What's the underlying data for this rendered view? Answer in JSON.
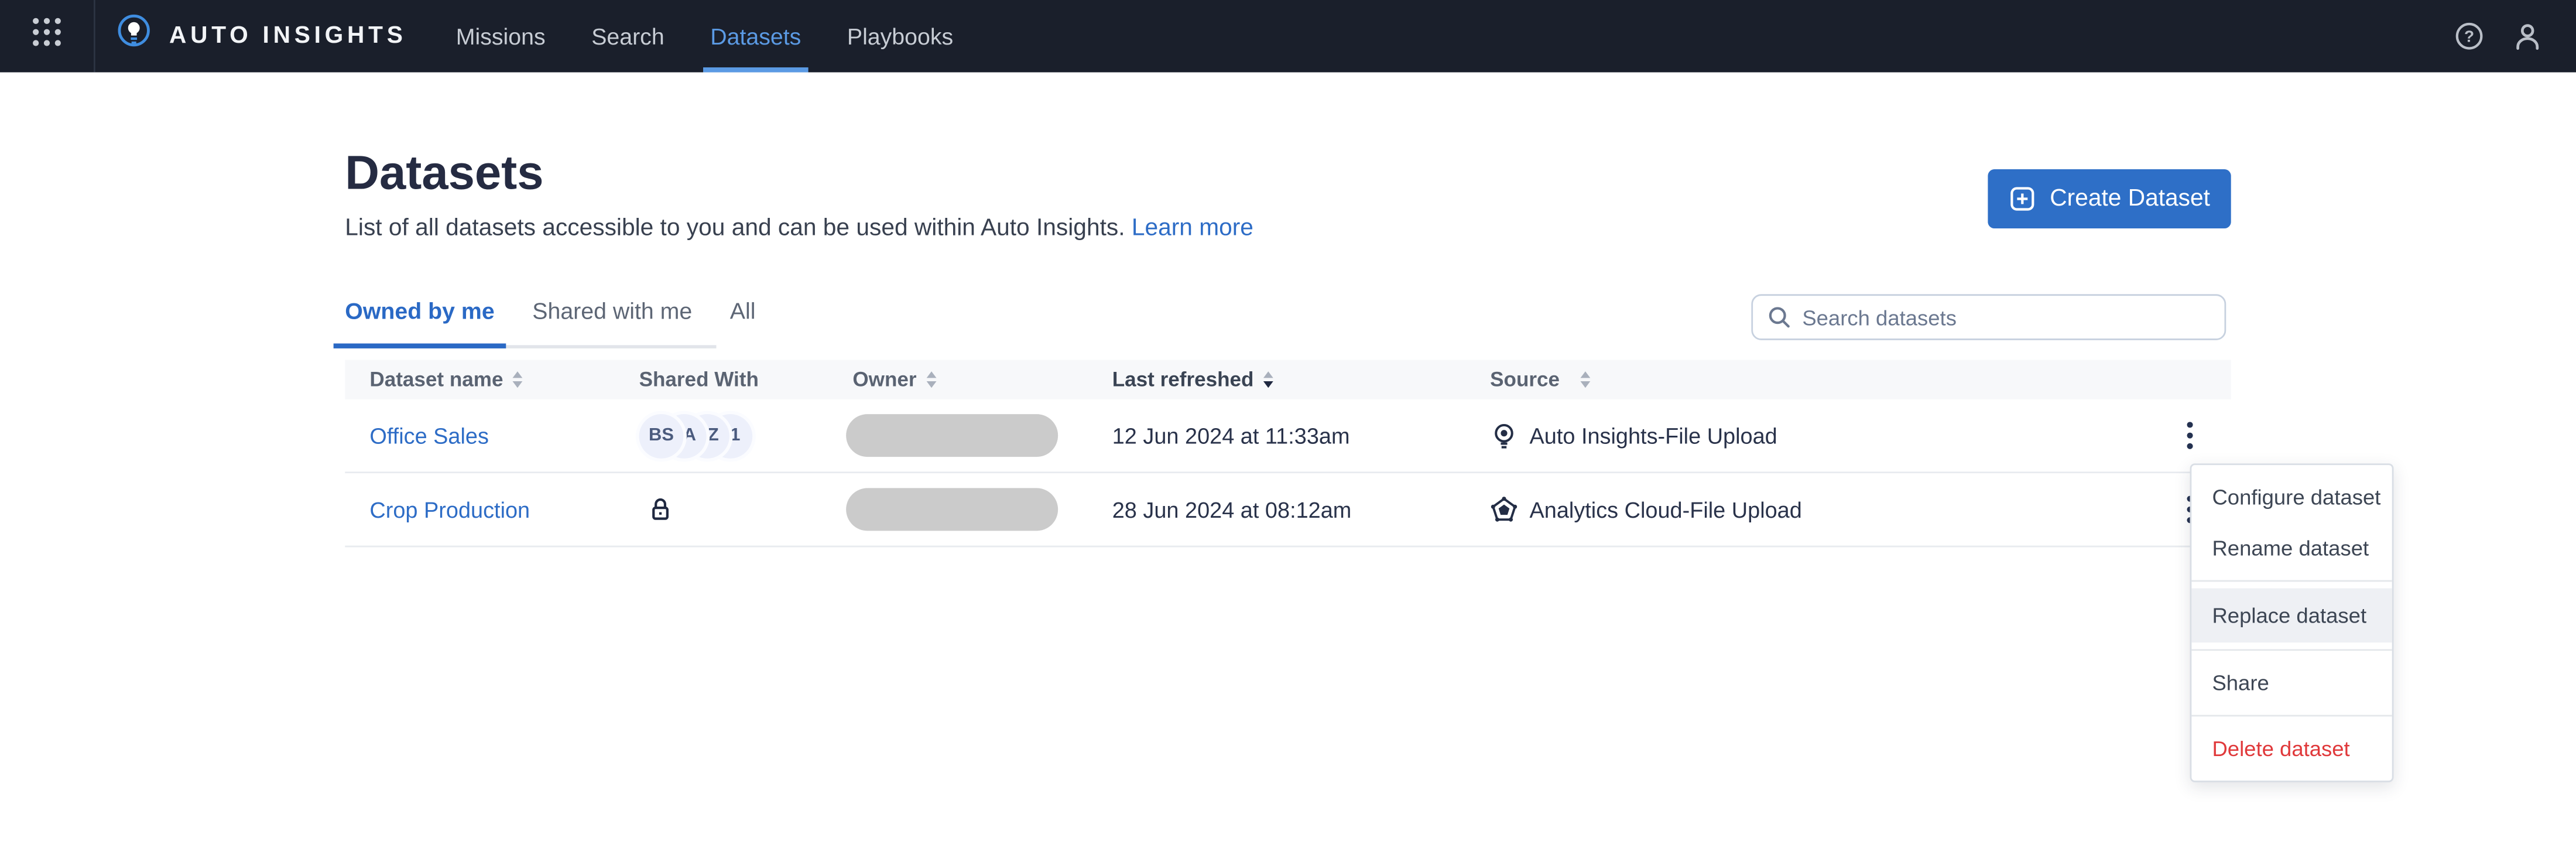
{
  "nav": {
    "brand": "AUTO INSIGHTS",
    "items": [
      {
        "label": "Missions",
        "active": false
      },
      {
        "label": "Search",
        "active": false
      },
      {
        "label": "Datasets",
        "active": true
      },
      {
        "label": "Playbooks",
        "active": false
      }
    ]
  },
  "page": {
    "title": "Datasets",
    "subtitle": "List of all datasets accessible to you and can be used within Auto Insights.",
    "learn_more_label": "Learn more",
    "create_button_label": "Create Dataset"
  },
  "tabs": {
    "items": [
      {
        "label": "Owned by me",
        "active": true
      },
      {
        "label": "Shared with me",
        "active": false
      },
      {
        "label": "All",
        "active": false
      }
    ]
  },
  "search": {
    "placeholder": "Search datasets"
  },
  "table": {
    "columns": [
      {
        "label": "Dataset name",
        "sortable": true
      },
      {
        "label": "Shared With",
        "sortable": false
      },
      {
        "label": "Owner",
        "sortable": true
      },
      {
        "label": "Last refreshed",
        "sortable": true,
        "sorted": "desc"
      },
      {
        "label": "Source",
        "sortable": true
      }
    ],
    "rows": [
      {
        "name": "Office Sales",
        "shared_avatars": [
          "BS",
          "VA",
          "SZ",
          "21"
        ],
        "owner_redacted": true,
        "last_refreshed": "12 Jun 2024 at 11:33am",
        "source": "Auto Insights-File Upload",
        "source_icon": "lightbulb-icon"
      },
      {
        "name": "Crop Production",
        "shared_private_lock": true,
        "owner_redacted": true,
        "last_refreshed": "28 Jun 2024 at 08:12am",
        "source": "Analytics Cloud-File Upload",
        "source_icon": "analytics-cloud-pentagon-icon"
      }
    ]
  },
  "context_menu": {
    "items": [
      {
        "label": "Configure dataset",
        "state": "normal"
      },
      {
        "label": "Rename dataset",
        "state": "normal"
      },
      {
        "label": "Replace dataset",
        "state": "highlighted"
      },
      {
        "label": "Share",
        "state": "normal"
      },
      {
        "label": "Delete dataset",
        "state": "danger"
      }
    ]
  },
  "colors": {
    "nav_bg": "#1a1f2b",
    "accent_blue": "#2e6fc7",
    "nav_active_blue": "#5b9ae4",
    "link_blue": "#2d6cc6",
    "danger_red": "#e0393b",
    "header_bg": "#f7f8fa",
    "avatar_bg": "#edf0fb",
    "owner_pill": "#cbcbcb"
  }
}
